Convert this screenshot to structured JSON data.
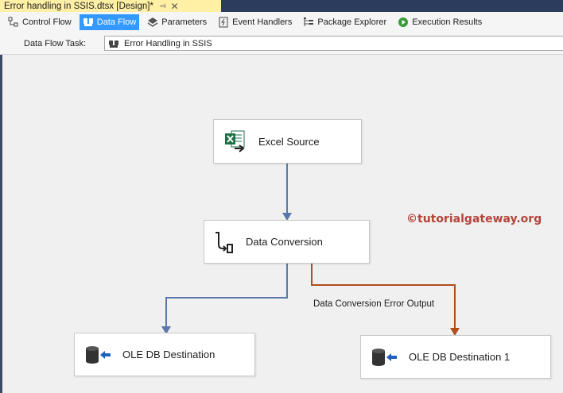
{
  "document_tab": {
    "title": "Error handling in SSIS.dtsx [Design]*",
    "pin_glyph": "⫤",
    "close_glyph": "✕"
  },
  "designer_tabs": [
    {
      "label": "Control Flow",
      "icon": "control-flow-icon",
      "active": false
    },
    {
      "label": "Data Flow",
      "icon": "data-flow-icon",
      "active": true
    },
    {
      "label": "Parameters",
      "icon": "parameters-icon",
      "active": false
    },
    {
      "label": "Event Handlers",
      "icon": "event-handlers-icon",
      "active": false
    },
    {
      "label": "Package Explorer",
      "icon": "package-explorer-icon",
      "active": false
    },
    {
      "label": "Execution Results",
      "icon": "execution-results-icon",
      "active": false
    }
  ],
  "task_row": {
    "label": "Data Flow Task:",
    "value": "Error Handling in SSIS"
  },
  "canvas": {
    "watermark": "©tutorialgateway.org",
    "nodes": {
      "excel_source": "Excel Source",
      "data_conversion": "Data Conversion",
      "ole_db_destination": "OLE DB Destination",
      "ole_db_destination_1": "OLE DB Destination 1"
    },
    "error_path_label": "Data Conversion Error Output"
  },
  "colors": {
    "tab_strip": "#2b3c5c",
    "active_doc_tab": "#fff0a6",
    "active_designer_tab": "#3399ff",
    "success_path": "#5a78a8",
    "error_path": "#b14e1c",
    "watermark": "#b5433a"
  }
}
